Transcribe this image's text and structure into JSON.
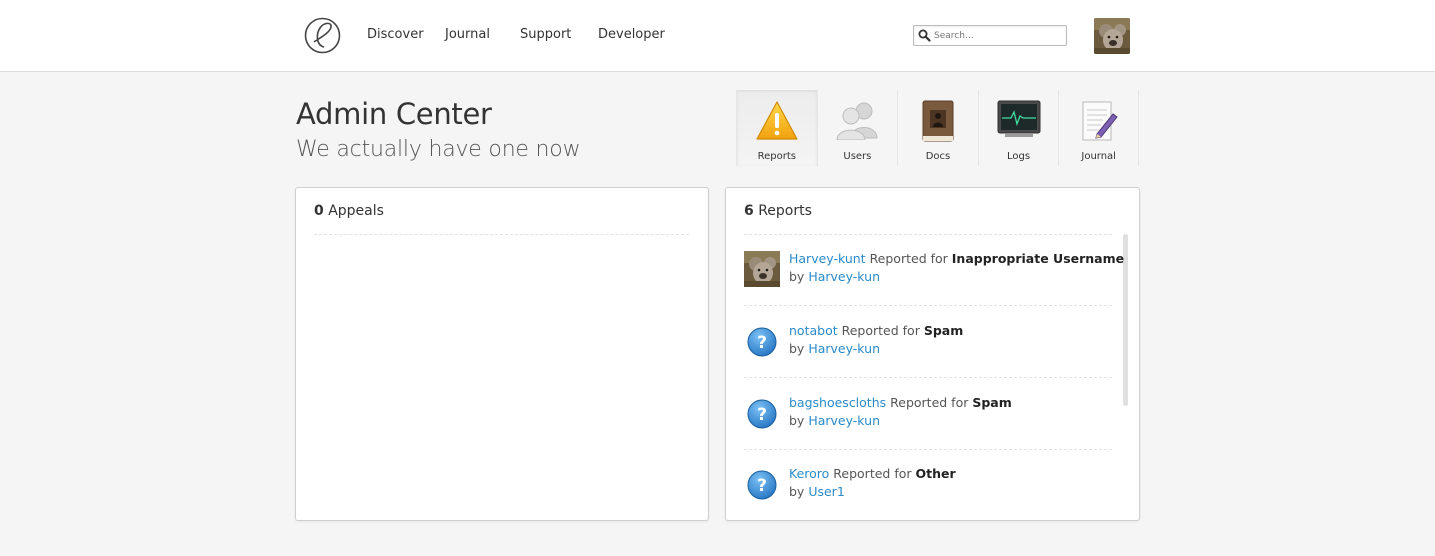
{
  "nav": {
    "items": [
      "Discover",
      "Journal",
      "Support",
      "Developer"
    ],
    "search_placeholder": "Search…"
  },
  "header": {
    "title": "Admin Center",
    "subtitle": "We actually have one now"
  },
  "tabs": [
    {
      "label": "Reports",
      "icon": "warning-icon",
      "active": true
    },
    {
      "label": "Users",
      "icon": "users-icon",
      "active": false
    },
    {
      "label": "Docs",
      "icon": "docs-book-icon",
      "active": false
    },
    {
      "label": "Logs",
      "icon": "logs-monitor-icon",
      "active": false
    },
    {
      "label": "Journal",
      "icon": "journal-pencil-icon",
      "active": false
    }
  ],
  "appeals": {
    "count": "0",
    "label": "Appeals"
  },
  "reports": {
    "count": "6",
    "label": "Reports",
    "items": [
      {
        "user": "Harvey-kunt",
        "text": "Reported for",
        "reason": "Inappropriate Username",
        "by": "by",
        "reporter": "Harvey-kun",
        "avatar": "koala-avatar"
      },
      {
        "user": "notabot",
        "text": "Reported for",
        "reason": "Spam",
        "by": "by",
        "reporter": "Harvey-kun",
        "avatar": "question-icon"
      },
      {
        "user": "bagshoescloths",
        "text": "Reported for",
        "reason": "Spam",
        "by": "by",
        "reporter": "Harvey-kun",
        "avatar": "question-icon"
      },
      {
        "user": "Keroro",
        "text": "Reported for",
        "reason": "Other",
        "by": "by",
        "reporter": "User1",
        "avatar": "question-icon"
      }
    ]
  },
  "colors": {
    "link": "#2a8bc9",
    "background": "#f5f5f5",
    "question_blue": "#2f87d3"
  }
}
